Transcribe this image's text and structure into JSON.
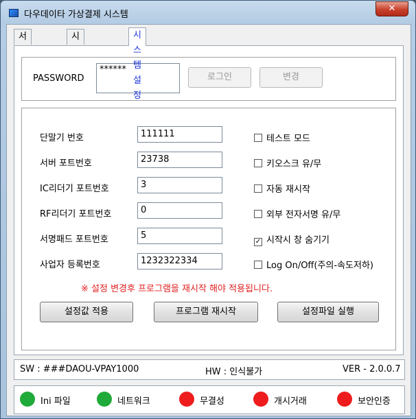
{
  "window": {
    "title": "다우데이타 가상결제 시스템",
    "close": "✕"
  },
  "tabs": [
    "서버 상태",
    "시스템 상태",
    "시스템 설정"
  ],
  "login": {
    "password_label": "PASSWORD",
    "password_value": "******",
    "login_button": "로그인",
    "change_button": "변경"
  },
  "settings": {
    "fields": [
      {
        "label": "단말기 번호",
        "value": "111111"
      },
      {
        "label": "서버 포트번호",
        "value": "23738"
      },
      {
        "label": "IC리더기 포트번호",
        "value": "3"
      },
      {
        "label": "RF리더기 포트번호",
        "value": "0"
      },
      {
        "label": "서명패드 포트번호",
        "value": "5"
      },
      {
        "label": "사업자 등록번호",
        "value": "1232322334"
      }
    ],
    "checkboxes": [
      {
        "label": "테스트 모드",
        "checked": false
      },
      {
        "label": "키오스크 유/무",
        "checked": false
      },
      {
        "label": "자동 재시작",
        "checked": false
      },
      {
        "label": "외부 전자서명 유/무",
        "checked": false
      },
      {
        "label": "시작시 창 숨기기",
        "checked": true
      },
      {
        "label": "Log On/Off(주의-속도저하)",
        "checked": false
      }
    ],
    "notice": "※ 설정 변경후 프로그램을 재시작 해야 적용됩니다.",
    "buttons": [
      "설정값 적용",
      "프로그램 재시작",
      "설정파일 실행"
    ]
  },
  "status": {
    "sw": "SW : ###DAOU-VPAY1000",
    "hw": "HW : 인식불가",
    "ver": "VER - 2.0.0.7"
  },
  "indicators": [
    {
      "label": "Ini 파일",
      "color": "#1faa3a"
    },
    {
      "label": "네트워크",
      "color": "#1faa3a"
    },
    {
      "label": "무결성",
      "color": "#ee1c1c"
    },
    {
      "label": "개시거래",
      "color": "#ee1c1c"
    },
    {
      "label": "보안인증",
      "color": "#ee1c1c"
    }
  ]
}
